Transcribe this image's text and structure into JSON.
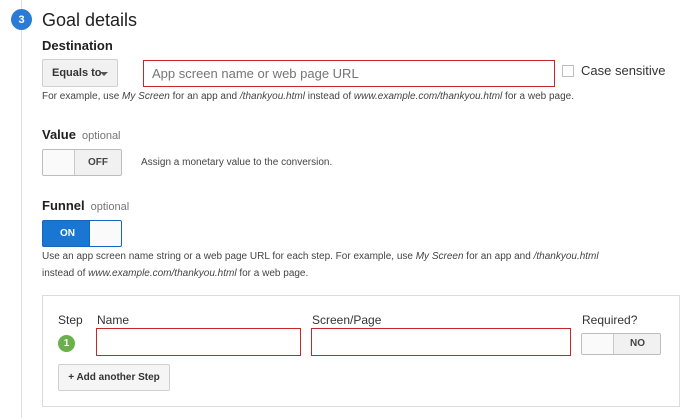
{
  "section": {
    "number": "3",
    "title": "Goal details"
  },
  "destination": {
    "label": "Destination",
    "match_type": "Equals to",
    "placeholder": "App screen name or web page URL",
    "case_sensitive_label": "Case sensitive",
    "help": {
      "p1": "For example, use ",
      "e1": "My Screen",
      "p2": " for an app and ",
      "e2": "/thankyou.html",
      "p3": " instead of ",
      "e3": "www.example.com/thankyou.html",
      "p4": " for a web page."
    }
  },
  "value": {
    "label": "Value",
    "optional": "optional",
    "toggle": "OFF",
    "description": "Assign a monetary value to the conversion."
  },
  "funnel": {
    "label": "Funnel",
    "optional": "optional",
    "toggle": "ON",
    "help": {
      "p1": "Use an app screen name string or a web page URL for each step. For example, use ",
      "e1": "My Screen",
      "p2": " for an app and ",
      "e2": "/thankyou.html",
      "p3": "instead of ",
      "e3": "www.example.com/thankyou.html",
      "p4": " for a web page."
    },
    "columns": {
      "step": "Step",
      "name": "Name",
      "screen": "Screen/Page",
      "required": "Required?"
    },
    "steps": [
      {
        "number": "1",
        "required": "NO"
      }
    ],
    "add_step_label": "+ Add another Step"
  }
}
